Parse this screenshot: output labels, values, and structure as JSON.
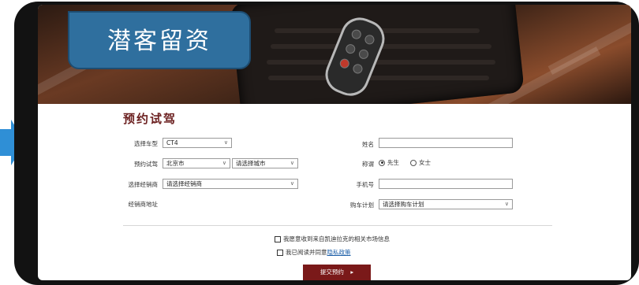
{
  "banner": {
    "title": "潜客留资"
  },
  "form": {
    "title": "预约试驾",
    "car_model": {
      "label": "选择车型",
      "value": "CT4"
    },
    "test_drive": {
      "label": "预约试驾",
      "province": "北京市",
      "city_placeholder": "请选择城市"
    },
    "dealer": {
      "label": "选择经销商",
      "placeholder": "请选择经销商"
    },
    "dealer_address": {
      "label": "经销商地址"
    },
    "name": {
      "label": "姓名",
      "value": ""
    },
    "title_field": {
      "label": "称谓",
      "options": [
        "先生",
        "女士"
      ],
      "selected": "先生"
    },
    "phone": {
      "label": "手机号",
      "value": ""
    },
    "purchase_plan": {
      "label": "购车计划",
      "placeholder": "请选择购车计划"
    }
  },
  "consent": {
    "marketing_label": "我愿意收到来自凯迪拉克的相关市场信息",
    "privacy_prefix": "我已阅读并同意",
    "privacy_link": "隐私政策"
  },
  "submit": {
    "label": "提交预约",
    "arrow": "▸"
  },
  "icons": {
    "dropdown": "chevron-down-icon",
    "pointer": "arrow-right-icon"
  },
  "colors": {
    "badge": "#2f6f9e",
    "brand": "#7a1919",
    "title_text": "#6b1f1f",
    "arrow": "#2f8fd6"
  }
}
